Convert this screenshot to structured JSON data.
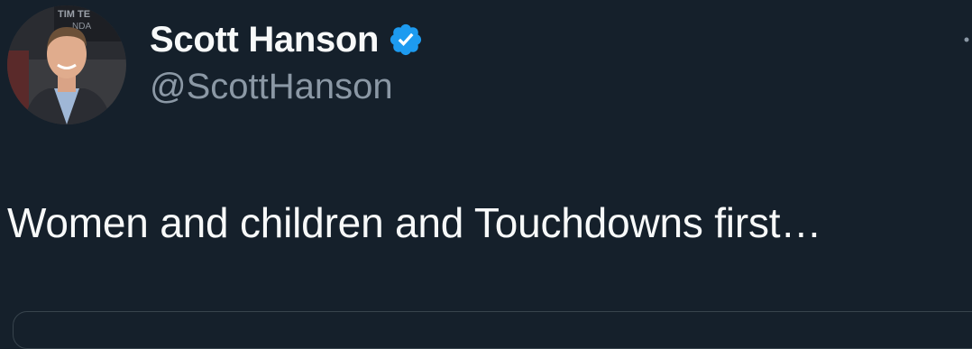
{
  "tweet": {
    "author": {
      "display_name": "Scott Hanson",
      "handle": "@ScottHanson",
      "verified": true,
      "avatar_icon": "profile-photo"
    },
    "text": "Women and children and Touchdowns first…",
    "more_icon": "more-options-icon"
  },
  "colors": {
    "background": "#15202b",
    "primary_text": "#f7f9f9",
    "secondary_text": "#8b98a5",
    "verified_badge": "#1d9bf0",
    "border": "#38444d"
  }
}
